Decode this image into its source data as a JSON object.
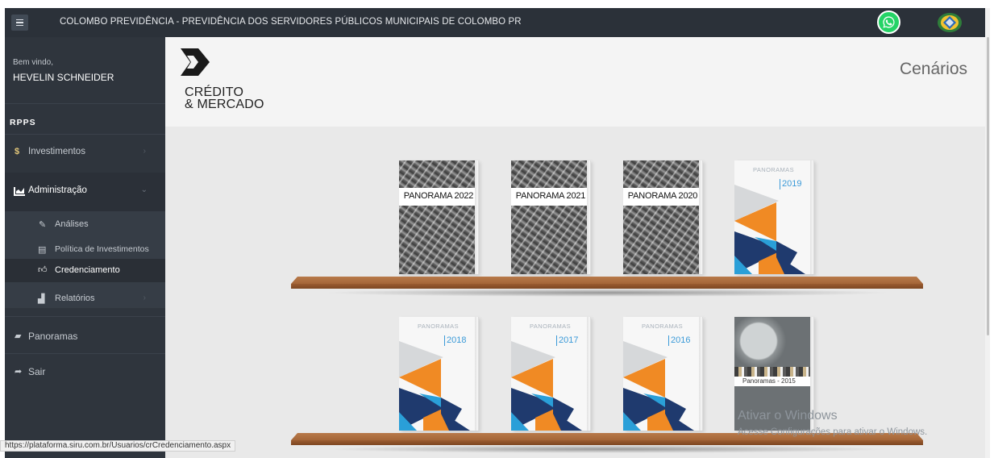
{
  "header": {
    "title": "COLOMBO PREVIDÊNCIA - PREVIDÊNCIA DOS SERVIDORES PÚBLICOS MUNICIPAIS DE COLOMBO  PR",
    "icons": [
      "menu-icon",
      "whatsapp-icon",
      "inss-icon"
    ]
  },
  "sidebar": {
    "welcome": "Bem vindo,",
    "username": "HEVELIN SCHNEIDER",
    "section": "RPPS",
    "items": [
      {
        "label": "Investimentos",
        "icon": "dollar-icon"
      },
      {
        "label": "Administração",
        "icon": "chart-icon"
      },
      {
        "label": "Análises",
        "icon": "edit-icon"
      },
      {
        "label": "Política de Investimentos",
        "icon": "list-icon"
      },
      {
        "label": "Credenciamento",
        "icon": "thumbs-up-icon"
      },
      {
        "label": "Relatórios",
        "icon": "chart-bar-icon"
      },
      {
        "label": "Panoramas",
        "icon": "book-icon"
      },
      {
        "label": "Sair",
        "icon": "share-icon"
      }
    ]
  },
  "brand": {
    "line1": "CRÉDITO",
    "line2": "& MERCADO"
  },
  "page": {
    "title": "Cenários"
  },
  "colors": {
    "navy": "#1f3a6e",
    "orange": "#f08a24",
    "blue": "#2a9fd8",
    "gray": "#d6d8da",
    "shelf": "#a86a3c"
  },
  "books": [
    {
      "kind": "photo",
      "label": "PANORAMA 2022"
    },
    {
      "kind": "photo",
      "label": "PANORAMA 2021"
    },
    {
      "kind": "photo",
      "label": "PANORAMA 2020"
    },
    {
      "kind": "panorama",
      "label": "PANORAMAS",
      "year": "2019"
    },
    {
      "kind": "panorama",
      "label": "PANORAMAS",
      "year": "2018"
    },
    {
      "kind": "panorama",
      "label": "PANORAMAS",
      "year": "2017"
    },
    {
      "kind": "panorama",
      "label": "PANORAMAS",
      "year": "2016"
    },
    {
      "kind": "globe",
      "label": "Panoramas - 2015"
    }
  ],
  "watermark": {
    "title": "Ativar o Windows",
    "subtitle": "Acesse Configurações para ativar o Windows."
  },
  "status_url": "https://plataforma.siru.com.br/Usuarios/crCredenciamento.aspx"
}
